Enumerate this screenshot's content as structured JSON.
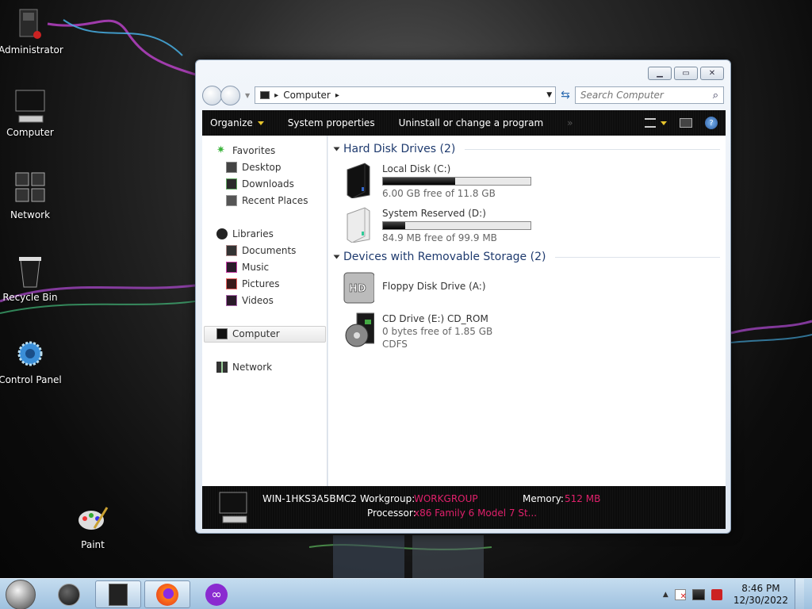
{
  "desktop": {
    "icons": [
      {
        "label": "Administrator"
      },
      {
        "label": "Computer"
      },
      {
        "label": "Network"
      },
      {
        "label": "Recycle Bin"
      },
      {
        "label": "Control Panel"
      },
      {
        "label": "Paint"
      }
    ]
  },
  "window": {
    "controls": {
      "minimize": "▁",
      "maximize": "▭",
      "close": "✕"
    },
    "address": {
      "segment": "Computer",
      "arrow": "▸"
    },
    "search": {
      "placeholder": "Search Computer"
    },
    "toolbar": {
      "organize": "Organize",
      "system_properties": "System properties",
      "uninstall": "Uninstall or change a program",
      "overflow": "»"
    },
    "sidebar": {
      "favorites": "Favorites",
      "desktop": "Desktop",
      "downloads": "Downloads",
      "recent_places": "Recent Places",
      "libraries": "Libraries",
      "documents": "Documents",
      "music": "Music",
      "pictures": "Pictures",
      "videos": "Videos",
      "computer": "Computer",
      "network": "Network"
    },
    "content": {
      "hard_disk_header": "Hard Disk Drives (2)",
      "removable_header": "Devices with Removable Storage (2)",
      "drives": [
        {
          "name": "Local Disk (C:)",
          "free": "6.00 GB free of 11.8 GB",
          "used_fraction": 0.49
        },
        {
          "name": "System Reserved (D:)",
          "free": "84.9 MB free of 99.9 MB",
          "used_fraction": 0.15
        }
      ],
      "floppy": {
        "name": "Floppy Disk Drive (A:)"
      },
      "cd": {
        "name": "CD Drive (E:) CD_ROM",
        "free": "0 bytes free of 1.85 GB",
        "fs": "CDFS"
      }
    },
    "details": {
      "computer_name": "WIN-1HKS3A5BMC2",
      "workgroup_label": "Workgroup:",
      "workgroup_value": "WORKGROUP",
      "memory_label": "Memory:",
      "memory_value": "512 MB",
      "processor_label": "Processor:",
      "processor_value": "x86 Family 6 Model 7 St..."
    }
  },
  "taskbar": {
    "time": "8:46 PM",
    "date": "12/30/2022",
    "show_hidden": "▲"
  },
  "colors": {
    "accent_pink": "#e0206b",
    "toolbar_bg": "#0a0a0a",
    "taskbar_bg": "#b2cfe7"
  }
}
